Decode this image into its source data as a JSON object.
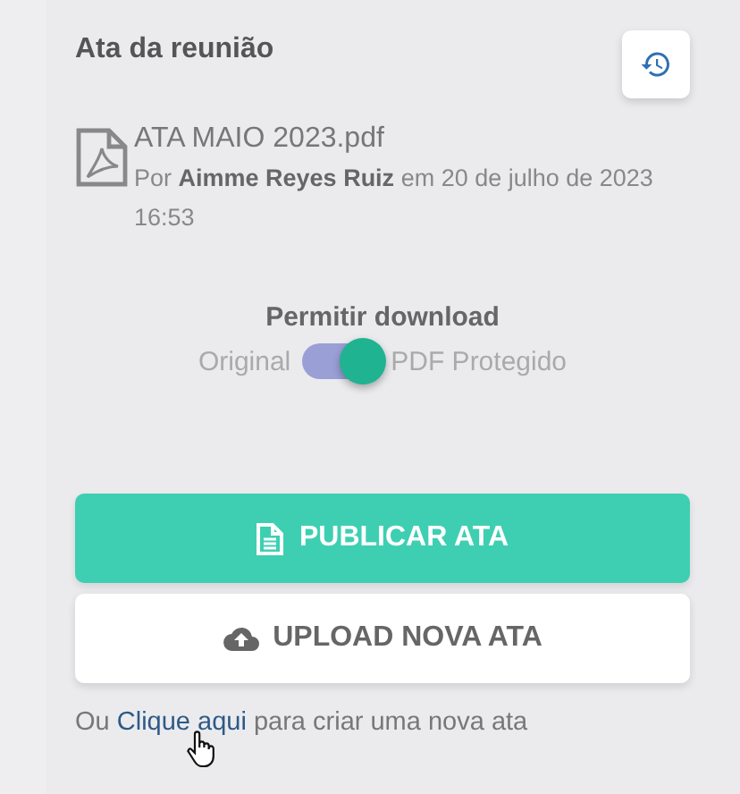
{
  "section": {
    "title": "Ata da reunião"
  },
  "file": {
    "name": "ATA MAIO 2023.pdf",
    "meta": "Por **Aimme Reyes Ruiz** em 20 de julho de 2023 16:53"
  },
  "download": {
    "label": "Permitir download",
    "off_label": "Original",
    "on_label": "PDF Protegido",
    "on": true
  },
  "buttons": [
    {
      "kind": "primary",
      "label": "PUBLICAR ATA"
    },
    {
      "kind": "secondary",
      "label": "UPLOAD NOVA ATA"
    }
  ],
  "footer": {
    "before": "Ou",
    "link": "Clique aqui",
    "after": "para criar uma nova ata"
  }
}
